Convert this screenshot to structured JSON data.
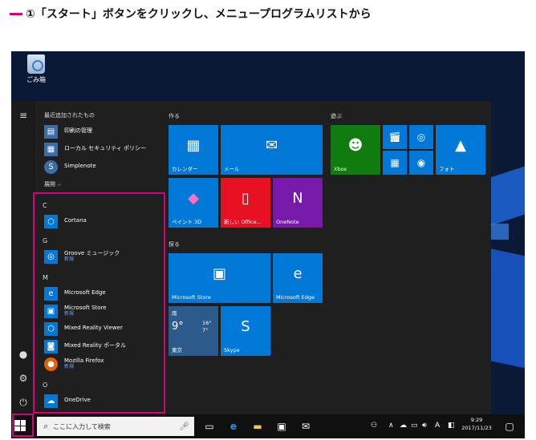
{
  "caption": "①「スタート」ボタンをクリックし、メニュープログラムリストから",
  "desktop": {
    "recycle_bin_label": "ごみ箱"
  },
  "list": {
    "recent_header": "最近追加されたもの",
    "recent": [
      {
        "label": "印刷の管理",
        "icon": "printer-icon"
      },
      {
        "label": "ローカル セキュリティ ポリシー",
        "icon": "security-policy-icon"
      },
      {
        "label": "Simplenote",
        "icon": "simplenote-icon"
      }
    ],
    "expand_label": "展開 ⌵",
    "letters": {
      "c": "C",
      "g": "G",
      "m": "M",
      "o": "O"
    },
    "apps": [
      {
        "label": "Cortana",
        "sub": "",
        "icon": "cortana-icon",
        "color": "#0078d7"
      },
      {
        "label": "Groove ミュージック",
        "sub": "新規",
        "icon": "groove-music-icon",
        "color": "#0078d7"
      },
      {
        "label": "Microsoft Edge",
        "sub": "",
        "icon": "edge-icon",
        "color": "#0078d7"
      },
      {
        "label": "Microsoft Store",
        "sub": "新規",
        "icon": "store-icon",
        "color": "#0078d7"
      },
      {
        "label": "Mixed Reality Viewer",
        "sub": "",
        "icon": "mixed-reality-viewer-icon",
        "color": "#0078d7"
      },
      {
        "label": "Mixed Reality ポータル",
        "sub": "",
        "icon": "mixed-reality-portal-icon",
        "color": "#0078d7"
      },
      {
        "label": "Mozilla Firefox",
        "sub": "新規",
        "icon": "firefox-icon",
        "color": "#e66000"
      },
      {
        "label": "OneDrive",
        "sub": "",
        "icon": "onedrive-icon",
        "color": "#0078d7"
      }
    ]
  },
  "groups": {
    "create": "作る",
    "play": "遊ぶ",
    "explore": "探る"
  },
  "tiles": {
    "calendar": "カレンダー",
    "mail": "メール",
    "xbox": "Xbox",
    "photos": "フォト",
    "paint3d": "ペイント 3D",
    "office": "新しい Office...",
    "onenote": "OneNote",
    "store": "Microsoft Store",
    "edge": "Microsoft Edge",
    "weather_title": "雨",
    "weather_temp": "9°",
    "weather_high": "16°",
    "weather_low": "7°",
    "weather_city": "東京",
    "skype": "Skype"
  },
  "colors": {
    "accent": "#0078d7",
    "office": "#e81123",
    "onenote": "#7719aa",
    "xbox": "#107c10",
    "highlight": "#d6007a"
  },
  "taskbar": {
    "search_placeholder": "ここに入力して検索",
    "time": "9:29",
    "date": "2017/11/23"
  }
}
